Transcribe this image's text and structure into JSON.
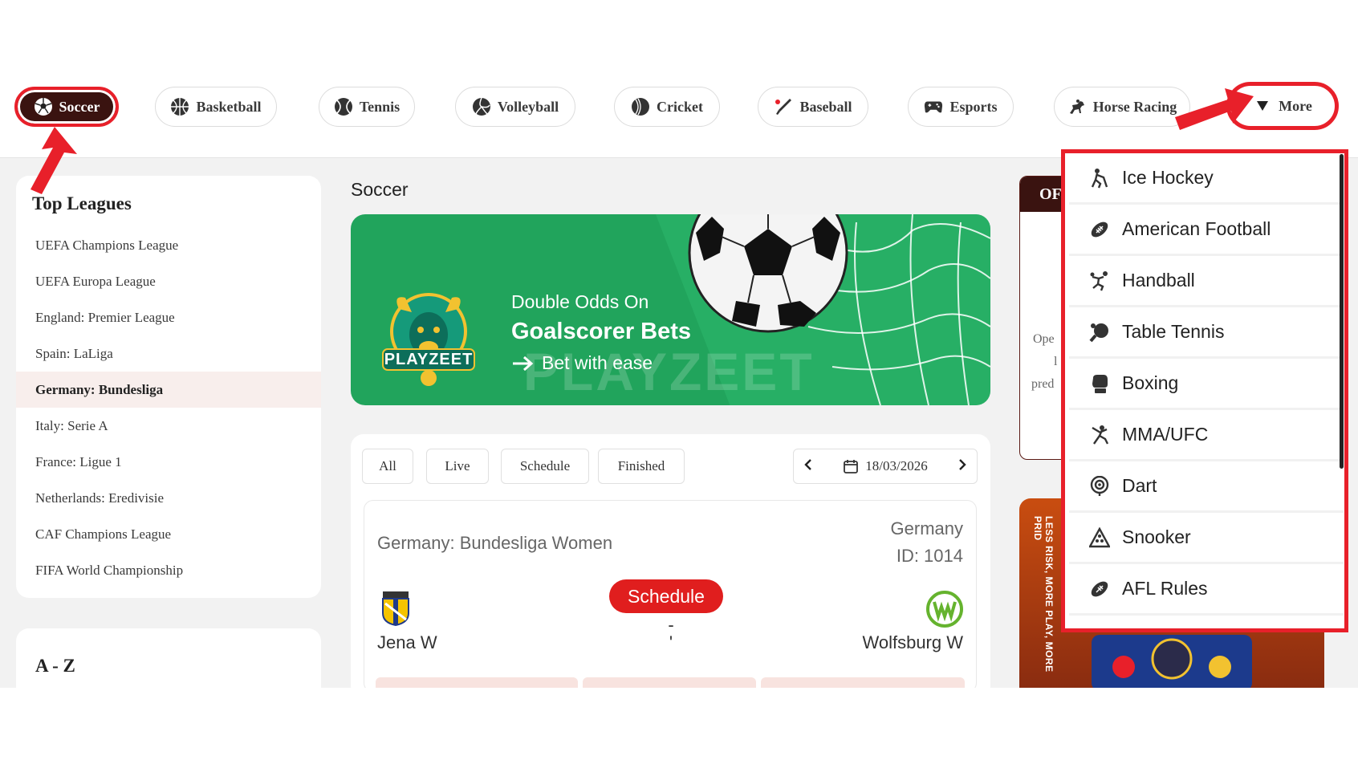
{
  "nav": {
    "items": [
      {
        "label": "Soccer",
        "icon": "soccer-ball-icon"
      },
      {
        "label": "Basketball",
        "icon": "basketball-icon"
      },
      {
        "label": "Tennis",
        "icon": "tennis-ball-icon"
      },
      {
        "label": "Volleyball",
        "icon": "volleyball-icon"
      },
      {
        "label": "Cricket",
        "icon": "cricket-ball-icon"
      },
      {
        "label": "Baseball",
        "icon": "baseball-bat-icon"
      },
      {
        "label": "Esports",
        "icon": "gamepad-icon"
      },
      {
        "label": "Horse Racing",
        "icon": "horse-racing-icon"
      }
    ],
    "more_label": "More",
    "active": "Soccer"
  },
  "sidebar": {
    "top_leagues_title": "Top Leagues",
    "leagues": [
      "UEFA Champions League",
      "UEFA Europa League",
      "England: Premier League",
      "Spain: LaLiga",
      "Germany: Bundesliga",
      "Italy: Serie A",
      "France: Ligue 1",
      "Netherlands: Eredivisie",
      "CAF Champions League",
      "FIFA World Championship"
    ],
    "selected_league": "Germany: Bundesliga",
    "az_title": "A - Z"
  },
  "main": {
    "title": "Soccer",
    "banner": {
      "line1": "Double Odds On",
      "line2": "Goalscorer Bets",
      "line3": "Bet with ease",
      "logo_text": "PLAYZEET",
      "watermark": "PLAYZEET"
    },
    "filters": [
      "All",
      "Live",
      "Schedule",
      "Finished"
    ],
    "date": "18/03/2026",
    "match": {
      "league": "Germany: Bundesliga Women",
      "country": "Germany",
      "id_text": "ID: 1014",
      "status": "Schedule",
      "score": "-",
      "time": "'",
      "home": "Jena W",
      "away": "Wolfsburg W"
    }
  },
  "right_panel": {
    "header_text": "OF",
    "text_lines": [
      "Ope",
      "l",
      "pred"
    ],
    "promo_vertical": "LESS RISK, MORE PLAY, MORE PRID"
  },
  "more_menu": {
    "items": [
      {
        "label": "Ice Hockey",
        "icon": "ice-hockey-icon"
      },
      {
        "label": "American Football",
        "icon": "american-football-icon"
      },
      {
        "label": "Handball",
        "icon": "handball-icon"
      },
      {
        "label": "Table Tennis",
        "icon": "table-tennis-icon"
      },
      {
        "label": "Boxing",
        "icon": "boxing-glove-icon"
      },
      {
        "label": "MMA/UFC",
        "icon": "mma-icon"
      },
      {
        "label": "Dart",
        "icon": "dart-icon"
      },
      {
        "label": "Snooker",
        "icon": "snooker-icon"
      },
      {
        "label": "AFL Rules",
        "icon": "afl-rules-icon"
      }
    ]
  },
  "colors": {
    "highlight_red": "#e8202a",
    "dark_brown": "#3a1310",
    "banner_green": "#21a45c",
    "status_red": "#e01e1e"
  }
}
